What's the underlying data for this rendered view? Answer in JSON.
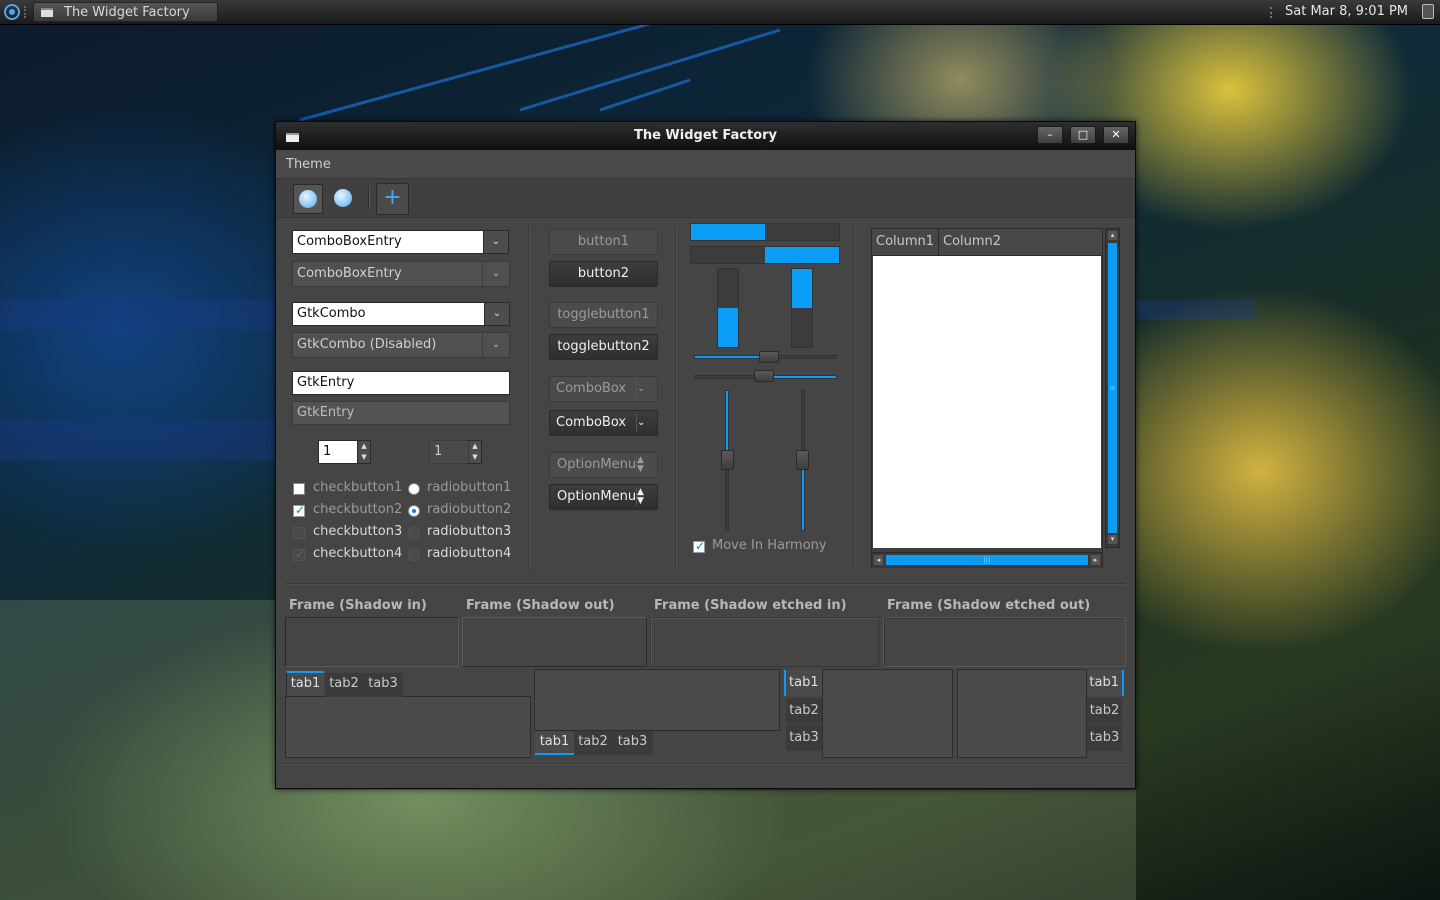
{
  "colors": {
    "accent": "#0b9cf5",
    "window_bg": "#454545"
  },
  "panel": {
    "task_title": "The Widget Factory",
    "clock": "Sat Mar  8,  9:01 PM",
    "menu_icon": "system-menu-icon",
    "trash_icon": "trash-icon"
  },
  "window": {
    "title": "The Widget Factory",
    "buttons": {
      "minimize": "–",
      "maximize": "□",
      "close": "✕"
    },
    "menu": {
      "theme": "Theme"
    },
    "toolbar": {
      "items": [
        "skip-back-icon",
        "skip-forward-icon",
        "plus-icon"
      ],
      "add_label": "+"
    }
  },
  "left": {
    "comboboxentry1": "ComboBoxEntry",
    "comboboxentry2": "ComboBoxEntry",
    "gtkcombo1": "GtkCombo",
    "gtkcombo2": "GtkCombo (Disabled)",
    "entry1": "GtkEntry",
    "entry2": "GtkEntry",
    "spin1": "1",
    "spin2": "1",
    "checks": [
      "checkbutton1",
      "checkbutton2",
      "checkbutton3",
      "checkbutton4"
    ],
    "radios": [
      "radiobutton1",
      "radiobutton2",
      "radiobutton3",
      "radiobutton4"
    ]
  },
  "middle": {
    "button1": "button1",
    "button2": "button2",
    "toggle1": "togglebutton1",
    "toggle2": "togglebutton2",
    "combobox1": "ComboBox",
    "combobox2": "ComboBox",
    "optionmenu1": "OptionMenu",
    "optionmenu2": "OptionMenu"
  },
  "ranges": {
    "progress_h1": 0.5,
    "progress_h2": 0.5,
    "progress_v1": 0.5,
    "progress_v2": 0.5,
    "hscale1": 0.5,
    "hscale2": 0.5,
    "vscale1": 0.5,
    "vscale2": 0.5,
    "harmony_label": "Move In Harmony"
  },
  "tree": {
    "columns": [
      "Column1",
      "Column2"
    ]
  },
  "frames": [
    "Frame (Shadow in)",
    "Frame (Shadow out)",
    "Frame (Shadow etched in)",
    "Frame (Shadow etched out)"
  ],
  "notebooks": {
    "tabs": [
      "tab1",
      "tab2",
      "tab3"
    ]
  }
}
